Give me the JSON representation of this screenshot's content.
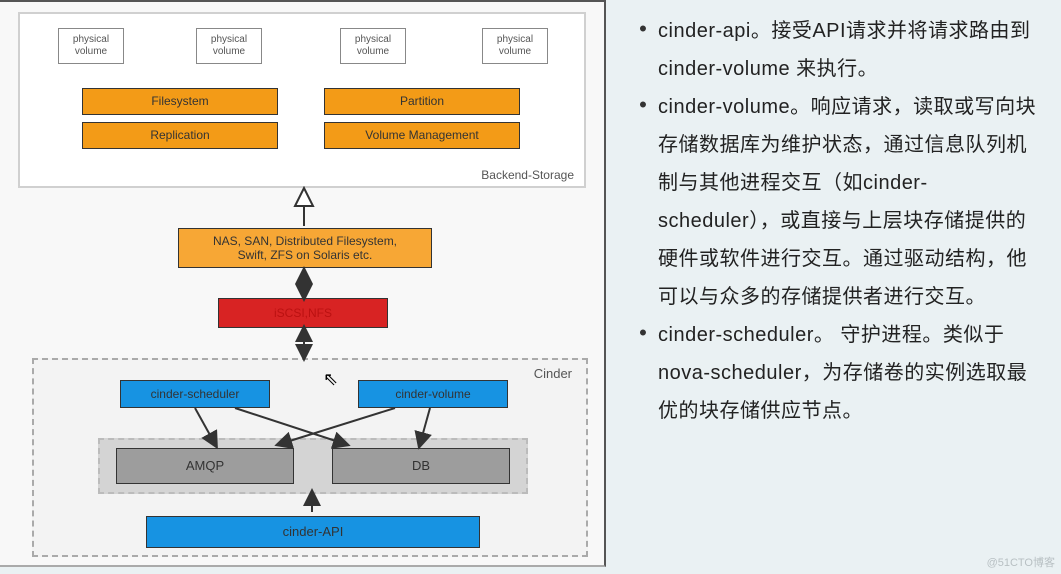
{
  "diagram": {
    "backend": {
      "label": "Backend-Storage",
      "pv": "physical\nvolume",
      "filesystem": "Filesystem",
      "replication": "Replication",
      "partition": "Partition",
      "volmgmt": "Volume Management"
    },
    "nas": "NAS, SAN, Distributed Filesystem,\nSwift, ZFS on Solaris etc.",
    "iscsi": "iSCSI,NFS",
    "cinder": {
      "label": "Cinder",
      "scheduler": "cinder-scheduler",
      "volume": "cinder-volume",
      "amqp": "AMQP",
      "db": "DB",
      "api": "cinder-API"
    }
  },
  "bullets": {
    "b1": "cinder-api。接受API请求并将请求路由到 cinder-volume 来执行。",
    "b2": "cinder-volume。响应请求，读取或写向块存储数据库为维护状态，通过信息队列机制与其他进程交互（如cinder-scheduler），或直接与上层块存储提供的硬件或软件进行交互。通过驱动结构，他可以与众多的存储提供者进行交互。",
    "b3": "cinder-scheduler。 守护进程。类似于nova-scheduler，为存储卷的实例选取最优的块存储供应节点。"
  },
  "watermark": "@51CTO博客"
}
